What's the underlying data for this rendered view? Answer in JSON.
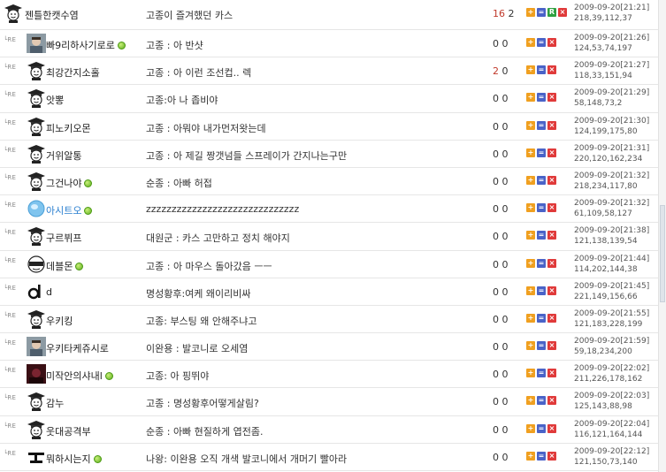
{
  "rows": [
    {
      "reply": false,
      "avatar": "student-cap-avatar",
      "nick": "젠틀한캣수염",
      "online": false,
      "blue": false,
      "msg": "고종이 즐겨했던 카스",
      "count_a": "16",
      "count_b": "2",
      "hot": true,
      "has_r": true,
      "datetime": "2009-09-20[21:21]",
      "ip": "218,39,112,37"
    },
    {
      "reply": true,
      "avatar": "photo-avatar",
      "nick": "빠9리하사기로로",
      "online": true,
      "blue": false,
      "msg": "고종 : 아 반샷",
      "count_a": "0",
      "count_b": "0",
      "hot": false,
      "has_r": false,
      "datetime": "2009-09-20[21:26]",
      "ip": "124,53,74,197"
    },
    {
      "reply": true,
      "avatar": "student-cap-avatar",
      "nick": "최강간지소홀",
      "online": false,
      "blue": false,
      "msg": "고종 : 아 이런 조선컵.. 렉",
      "count_a": "2",
      "count_b": "0",
      "hot": true,
      "has_r": false,
      "datetime": "2009-09-20[21:27]",
      "ip": "118,33,151,94"
    },
    {
      "reply": true,
      "avatar": "student-cap-avatar",
      "nick": "앗뽕",
      "online": false,
      "blue": false,
      "msg": "고종:아 나 좁비야",
      "count_a": "0",
      "count_b": "0",
      "hot": false,
      "has_r": false,
      "datetime": "2009-09-20[21:29]",
      "ip": "58,148,73,2"
    },
    {
      "reply": true,
      "avatar": "student-cap-avatar",
      "nick": "피노키오몬",
      "online": false,
      "blue": false,
      "msg": "고종 : 아뭐야 내가먼저왓는데",
      "count_a": "0",
      "count_b": "0",
      "hot": false,
      "has_r": false,
      "datetime": "2009-09-20[21:30]",
      "ip": "124,199,175,80"
    },
    {
      "reply": true,
      "avatar": "student-cap-avatar",
      "nick": "거위알통",
      "online": false,
      "blue": false,
      "msg": "고종 : 아 제길 짱갯넘들 스프레이가 간지나는구만",
      "count_a": "0",
      "count_b": "0",
      "hot": false,
      "has_r": false,
      "datetime": "2009-09-20[21:31]",
      "ip": "220,120,162,234"
    },
    {
      "reply": true,
      "avatar": "student-cap-avatar",
      "nick": "그건나야",
      "online": true,
      "blue": false,
      "msg": "순종 : 아빠 허접",
      "count_a": "0",
      "count_b": "0",
      "hot": false,
      "has_r": false,
      "datetime": "2009-09-20[21:32]",
      "ip": "218,234,117,80"
    },
    {
      "reply": true,
      "avatar": "globe-avatar",
      "nick": "아시트오",
      "online": true,
      "blue": true,
      "msg": "zzzzzzzzzzzzzzzzzzzzzzzzzzzzzz",
      "count_a": "0",
      "count_b": "0",
      "hot": false,
      "has_r": false,
      "datetime": "2009-09-20[21:32]",
      "ip": "61,109,58,127"
    },
    {
      "reply": true,
      "avatar": "student-cap-avatar",
      "nick": "구르뷔프",
      "online": false,
      "blue": false,
      "msg": "대원군 : 카스 고만하고 정치 해야지",
      "count_a": "0",
      "count_b": "0",
      "hot": false,
      "has_r": false,
      "datetime": "2009-09-20[21:38]",
      "ip": "121,138,139,54"
    },
    {
      "reply": true,
      "avatar": "visor-avatar",
      "nick": "데블몬",
      "online": true,
      "blue": false,
      "msg": "고종 : 아 마우스 돌아갔음 ㅡㅡ",
      "count_a": "0",
      "count_b": "0",
      "hot": false,
      "has_r": false,
      "datetime": "2009-09-20[21:44]",
      "ip": "114,202,144,38"
    },
    {
      "reply": true,
      "avatar": "d-logo-avatar",
      "nick": "d",
      "online": false,
      "blue": false,
      "msg": "명성황후:여케 왜이리비싸",
      "count_a": "0",
      "count_b": "0",
      "hot": false,
      "has_r": false,
      "datetime": "2009-09-20[21:45]",
      "ip": "221,149,156,66"
    },
    {
      "reply": true,
      "avatar": "student-cap-avatar",
      "nick": "우키킹",
      "online": false,
      "blue": false,
      "msg": "고종: 부스팅 왜 안해주냐고",
      "count_a": "0",
      "count_b": "0",
      "hot": false,
      "has_r": false,
      "datetime": "2009-09-20[21:55]",
      "ip": "121,183,228,199"
    },
    {
      "reply": true,
      "avatar": "photo-avatar",
      "nick": "우키타케쥬시로",
      "online": false,
      "blue": false,
      "msg": "이완용 : 발코니로 오세염",
      "count_a": "0",
      "count_b": "0",
      "hot": false,
      "has_r": false,
      "datetime": "2009-09-20[21:59]",
      "ip": "59,18,234,200"
    },
    {
      "reply": true,
      "avatar": "dark-photo-avatar",
      "nick": "미작안의샤내l",
      "online": true,
      "blue": false,
      "msg": "고종: 아 핑뛰야",
      "count_a": "0",
      "count_b": "0",
      "hot": false,
      "has_r": false,
      "datetime": "2009-09-20[22:02]",
      "ip": "211,226,178,162"
    },
    {
      "reply": true,
      "avatar": "student-cap-avatar",
      "nick": "감누",
      "online": false,
      "blue": false,
      "msg": "고종 : 명성황후어떻게살림?",
      "count_a": "0",
      "count_b": "0",
      "hot": false,
      "has_r": false,
      "datetime": "2009-09-20[22:03]",
      "ip": "125,143,88,98"
    },
    {
      "reply": true,
      "avatar": "student-cap-avatar",
      "nick": "웃대공격부",
      "online": false,
      "blue": false,
      "msg": "순종 : 아빠 현질하게 엽전좀.",
      "count_a": "0",
      "count_b": "0",
      "hot": false,
      "has_r": false,
      "datetime": "2009-09-20[22:04]",
      "ip": "116,121,164,144"
    },
    {
      "reply": true,
      "avatar": "symbol-avatar",
      "nick": "뭐하시는지",
      "online": true,
      "blue": false,
      "msg": "나왕: 이완용 오직 개색 발코니에서 개머기 빨아라",
      "count_a": "0",
      "count_b": "0",
      "hot": false,
      "has_r": false,
      "datetime": "2009-09-20[22:12]",
      "ip": "121,150,73,140"
    }
  ],
  "labels": {
    "reply_mark": "└RE",
    "btn_add": "+",
    "btn_eq": "=",
    "btn_r": "R",
    "btn_x": "×"
  },
  "colors": {
    "hot_count": "#c0392b",
    "nick_blue": "#2a7fd0",
    "btn_add": "#f0a020",
    "btn_eq": "#4a63c8",
    "btn_r": "#2fa040",
    "btn_x": "#e03a3a"
  }
}
